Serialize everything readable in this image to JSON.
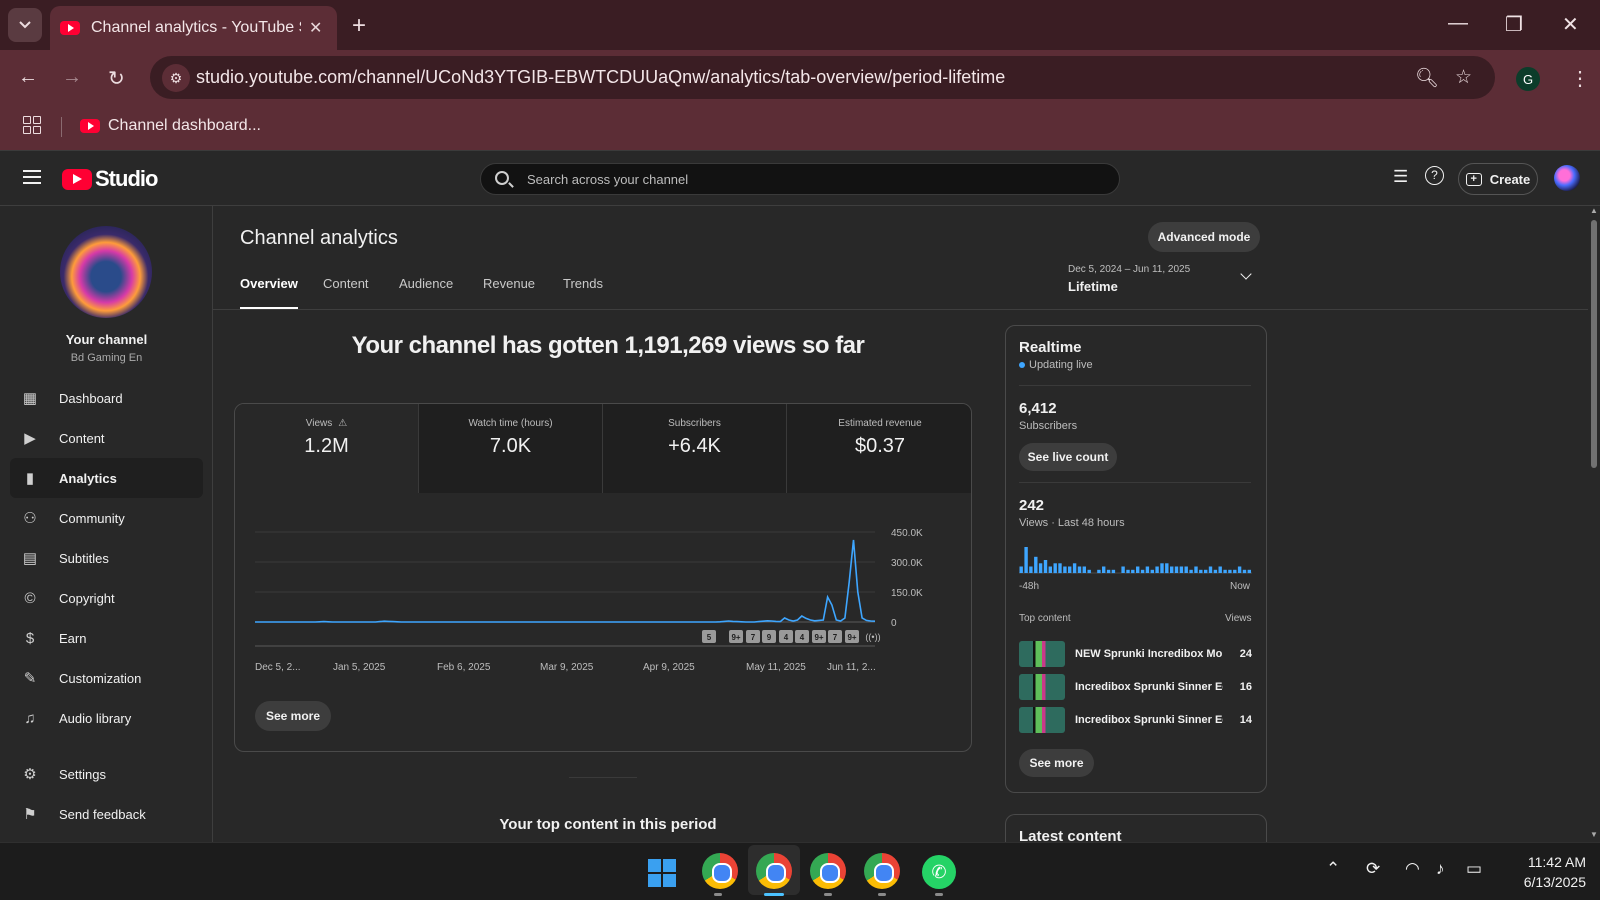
{
  "browser": {
    "tab_title": "Channel analytics - YouTube Studio",
    "url": "studio.youtube.com/channel/UCoNd3YTGIB-EBWTCDUUaQnw/analytics/tab-overview/period-lifetime",
    "profile_initial": "G",
    "bookmark_label": "Channel dashboard..."
  },
  "header": {
    "logo_text": "Studio",
    "search_placeholder": "Search across your channel",
    "create_label": "Create"
  },
  "sidebar": {
    "your_channel": "Your channel",
    "channel_name": "Bd Gaming En",
    "items": [
      {
        "label": "Dashboard",
        "icon": "dashboard-icon"
      },
      {
        "label": "Content",
        "icon": "content-icon"
      },
      {
        "label": "Analytics",
        "icon": "analytics-icon",
        "active": true
      },
      {
        "label": "Community",
        "icon": "community-icon"
      },
      {
        "label": "Subtitles",
        "icon": "subtitles-icon"
      },
      {
        "label": "Copyright",
        "icon": "copyright-icon"
      },
      {
        "label": "Earn",
        "icon": "earn-icon"
      },
      {
        "label": "Customization",
        "icon": "customization-icon"
      },
      {
        "label": "Audio library",
        "icon": "audio-library-icon"
      },
      {
        "label": "Settings",
        "icon": "settings-icon"
      },
      {
        "label": "Send feedback",
        "icon": "feedback-icon"
      }
    ]
  },
  "main": {
    "title": "Channel analytics",
    "advanced_mode": "Advanced mode",
    "tabs": [
      "Overview",
      "Content",
      "Audience",
      "Revenue",
      "Trends"
    ],
    "date_range": "Dec 5, 2024 – Jun 11, 2025",
    "date_label": "Lifetime",
    "headline": "Your channel has gotten 1,191,269 views so far",
    "metrics": [
      {
        "label": "Views",
        "value": "1.2M",
        "warning": "⚠"
      },
      {
        "label": "Watch time (hours)",
        "value": "7.0K"
      },
      {
        "label": "Subscribers",
        "value": "+6.4K"
      },
      {
        "label": "Estimated revenue",
        "value": "$0.37"
      }
    ],
    "see_more": "See more",
    "top_content_title": "Your top content in this period"
  },
  "chart_data": {
    "type": "line",
    "series": [
      {
        "values": [
          0,
          0,
          0,
          0,
          0,
          0,
          0,
          0,
          0,
          0,
          0,
          0,
          0,
          0,
          0,
          1000,
          2000,
          1000,
          0,
          0,
          0,
          0,
          0,
          0,
          0,
          0,
          0,
          0,
          0,
          2000,
          4000,
          3000,
          2000,
          1000,
          0,
          0,
          0,
          0,
          0,
          0,
          0,
          0,
          0,
          0,
          0,
          0,
          0,
          0,
          0,
          0,
          0,
          0,
          0,
          0,
          0,
          0,
          0,
          0,
          0,
          0,
          0,
          0,
          0,
          0,
          0,
          0,
          0,
          0,
          0,
          0,
          0,
          0,
          0,
          0,
          0,
          0,
          0,
          0,
          0,
          0,
          0,
          0,
          0,
          0,
          0,
          0,
          0,
          0,
          0,
          0,
          0,
          0,
          0,
          0,
          0,
          0,
          0,
          0,
          0,
          0,
          0,
          0,
          0,
          0,
          0,
          0,
          0,
          0,
          1000,
          3000,
          5000,
          3000,
          2000,
          1000,
          0,
          0,
          0,
          2000,
          4000,
          6000,
          5000,
          3000,
          2000,
          20000,
          10000,
          5000,
          10000,
          30000,
          18000,
          10000,
          6000,
          8000,
          10000,
          125000,
          85000,
          10000,
          5000,
          20000,
          200000,
          410000,
          150000,
          20000,
          8000,
          5000,
          4000
        ]
      }
    ],
    "x_tick_labels": [
      "Dec 5, 2...",
      "Jan 5, 2025",
      "Feb 6, 2025",
      "Mar 9, 2025",
      "Apr 9, 2025",
      "May 11, 2025",
      "Jun 11, 2..."
    ],
    "y_tick_labels": [
      "450.0K",
      "300.0K",
      "150.0K",
      "0"
    ],
    "ylim": [
      0,
      450000
    ],
    "marker_badges": [
      "5",
      "9+",
      "7",
      "9",
      "4",
      "4",
      "9+",
      "7",
      "9+"
    ],
    "color": "#3ea6ff"
  },
  "realtime": {
    "title": "Realtime",
    "status": "Updating live",
    "subscribers_value": "6,412",
    "subscribers_label": "Subscribers",
    "see_live_count": "See live count",
    "views_value": "242",
    "views_label": "Views · Last 48 hours",
    "bars": [
      2,
      8,
      2,
      5,
      3,
      4,
      2,
      3,
      3,
      2,
      2,
      3,
      2,
      2,
      1,
      0,
      1,
      2,
      1,
      1,
      0,
      2,
      1,
      1,
      2,
      1,
      2,
      1,
      2,
      3,
      3,
      2,
      2,
      2,
      2,
      1,
      2,
      1,
      1,
      2,
      1,
      2,
      1,
      1,
      1,
      2,
      1,
      1
    ],
    "axis_start": "-48h",
    "axis_end": "Now",
    "top_content_label": "Top content",
    "views_col": "Views",
    "top_content": [
      {
        "title": "NEW Sprunki Incredibox Mo...",
        "views": "24"
      },
      {
        "title": "Incredibox Sprunki Sinner Ed...",
        "views": "16"
      },
      {
        "title": "Incredibox Sprunki Sinner Ed...",
        "views": "14"
      }
    ],
    "see_more": "See more"
  },
  "latest_content": {
    "title": "Latest content"
  },
  "taskbar": {
    "time": "11:42 AM",
    "date": "6/13/2025"
  }
}
